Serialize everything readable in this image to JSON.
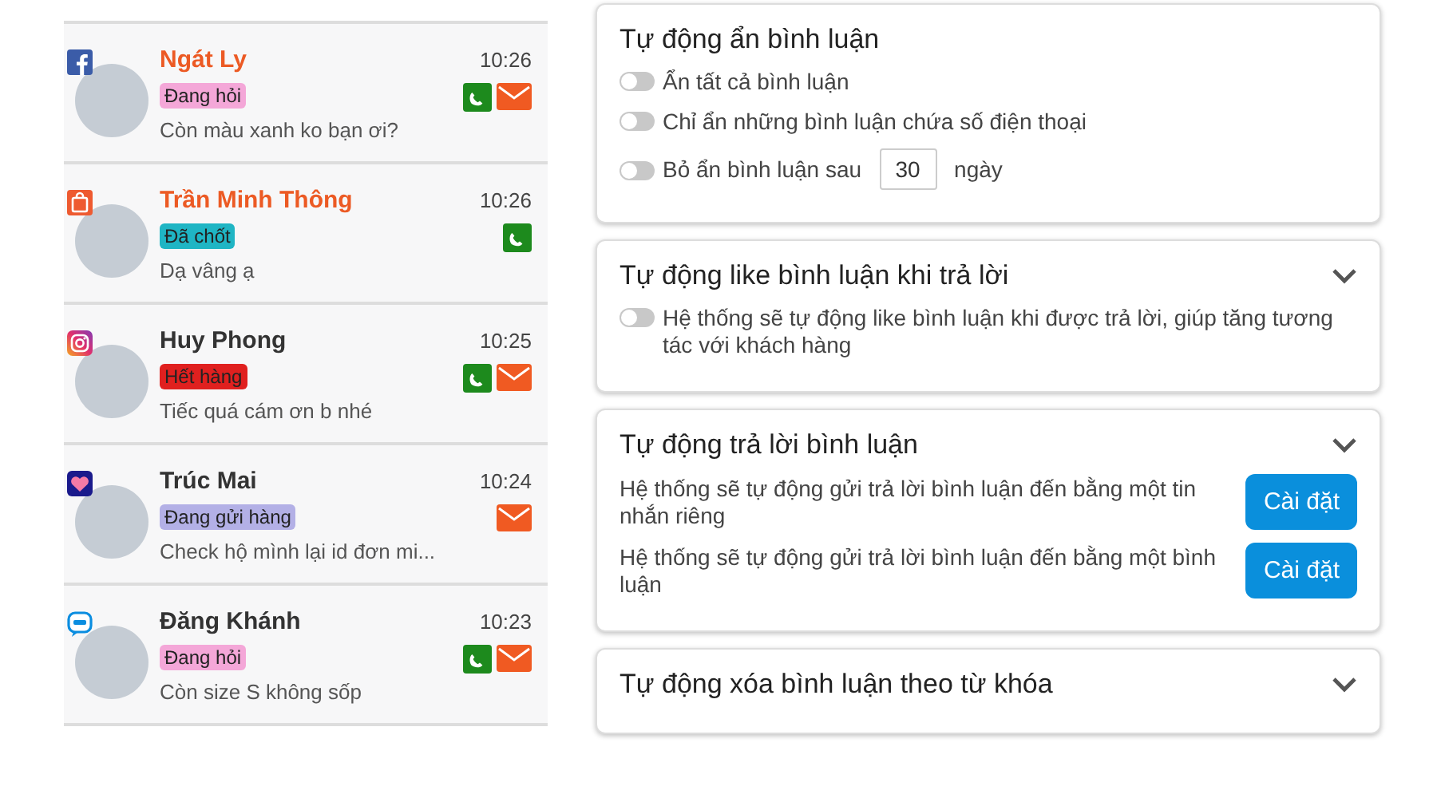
{
  "conversations": [
    {
      "kind": "facebook",
      "name": "Ngát Ly",
      "unread": true,
      "time": "10:26",
      "tag": {
        "label": "Đang hỏi",
        "color": "#f4a7d8"
      },
      "phone": true,
      "mail": true,
      "message": "Còn màu xanh ko bạn ơi?"
    },
    {
      "kind": "shopee",
      "name": "Trần Minh Thông",
      "unread": true,
      "time": "10:26",
      "tag": {
        "label": "Đã chốt",
        "color": "#1fb5c4"
      },
      "phone": true,
      "mail": false,
      "message": "Dạ vâng ạ"
    },
    {
      "kind": "instagram",
      "name": "Huy Phong",
      "unread": false,
      "time": "10:25",
      "tag": {
        "label": "Hết hàng",
        "color": "#e0201f"
      },
      "phone": true,
      "mail": true,
      "message": "Tiếc quá cám ơn b nhé"
    },
    {
      "kind": "lazada",
      "name": "Trúc Mai",
      "unread": false,
      "time": "10:24",
      "tag": {
        "label": "Đang gửi hàng",
        "color": "#b3b0e6"
      },
      "phone": false,
      "mail": true,
      "message": "Check hộ mình lại id đơn mi..."
    },
    {
      "kind": "zalo",
      "name": "Đăng Khánh",
      "unread": false,
      "time": "10:23",
      "tag": {
        "label": "Đang hỏi",
        "color": "#f4a7d8"
      },
      "phone": true,
      "mail": true,
      "message": "Còn size S không sốp"
    }
  ],
  "settings": [
    {
      "title": "Tự động ẩn bình luận",
      "chevron": false,
      "items": [
        {
          "kind": "toggle",
          "on": false,
          "label": "Ẩn tất cả bình luận"
        },
        {
          "kind": "toggle",
          "on": false,
          "label": "Chỉ ẩn những bình luận chứa số điện thoại"
        },
        {
          "kind": "toggle_input",
          "on": false,
          "label": "Bỏ ẩn bình luận sau",
          "value": "30",
          "suffix": "ngày"
        }
      ]
    },
    {
      "title": "Tự động like bình luận khi trả lời",
      "chevron": true,
      "items": [
        {
          "kind": "toggle",
          "on": false,
          "label": "Hệ thống sẽ tự động like bình luận khi được trả lời, giúp tăng tương tác với khách hàng"
        }
      ]
    },
    {
      "title": "Tự động trả lời bình luận",
      "chevron": true,
      "items": [
        {
          "kind": "action",
          "label": "Hệ thống sẽ tự động gửi trả lời bình luận đến bằng một tin nhắn riêng",
          "button": "Cài đặt"
        },
        {
          "kind": "action",
          "label": "Hệ thống sẽ tự động gửi trả lời bình luận đến bằng một bình luận",
          "button": "Cài đặt"
        }
      ]
    },
    {
      "title": "Tự động xóa bình luận theo từ khóa",
      "chevron": true
    }
  ]
}
